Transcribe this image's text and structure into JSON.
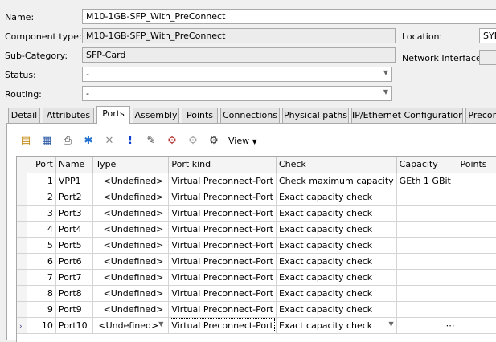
{
  "form": {
    "name_label": "Name:",
    "name_value": "M10-1GB-SFP_With_PreConnect",
    "component_type_label": "Component type:",
    "component_type_value": "M10-1GB-SFP_With_PreConnect",
    "subcategory_label": "Sub-Category:",
    "subcategory_value": "SFP-Card",
    "status_label": "Status:",
    "status_value": "-",
    "routing_label": "Routing:",
    "routing_value": "-",
    "location_label": "Location:",
    "location_value": "SYD",
    "network_interface_label": "Network Interface:",
    "network_interface_value": ""
  },
  "tabs": [
    {
      "label": "Detail"
    },
    {
      "label": "Attributes"
    },
    {
      "label": "Ports"
    },
    {
      "label": "Assembly"
    },
    {
      "label": "Points"
    },
    {
      "label": "Connections"
    },
    {
      "label": "Physical paths"
    },
    {
      "label": "IP/Ethernet Configuration"
    },
    {
      "label": "Precon"
    }
  ],
  "active_tab": "Ports",
  "toolbar": {
    "view_label": "View",
    "icons": [
      "new-port-icon",
      "edit-port-icon",
      "print-icon",
      "star-icon",
      "delete-icon",
      "exclamation-icon",
      "pick-icon",
      "global-port-icon",
      "port-settings-icon",
      "port-parameters-icon"
    ]
  },
  "grid": {
    "columns": [
      "Port",
      "Name",
      "Type",
      "Port kind",
      "Check",
      "Capacity",
      "Points"
    ],
    "rows": [
      {
        "port": "1",
        "name": "VPP1",
        "type": "<Undefined>",
        "kind": "Virtual Preconnect-Port",
        "check": "Check maximum capacity",
        "capacity": "GEth 1 GBit",
        "points": ""
      },
      {
        "port": "2",
        "name": "Port2",
        "type": "<Undefined>",
        "kind": "Virtual Preconnect-Port",
        "check": "Exact capacity check",
        "capacity": "",
        "points": ""
      },
      {
        "port": "3",
        "name": "Port3",
        "type": "<Undefined>",
        "kind": "Virtual Preconnect-Port",
        "check": "Exact capacity check",
        "capacity": "",
        "points": ""
      },
      {
        "port": "4",
        "name": "Port4",
        "type": "<Undefined>",
        "kind": "Virtual Preconnect-Port",
        "check": "Exact capacity check",
        "capacity": "",
        "points": ""
      },
      {
        "port": "5",
        "name": "Port5",
        "type": "<Undefined>",
        "kind": "Virtual Preconnect-Port",
        "check": "Exact capacity check",
        "capacity": "",
        "points": ""
      },
      {
        "port": "6",
        "name": "Port6",
        "type": "<Undefined>",
        "kind": "Virtual Preconnect-Port",
        "check": "Exact capacity check",
        "capacity": "",
        "points": ""
      },
      {
        "port": "7",
        "name": "Port7",
        "type": "<Undefined>",
        "kind": "Virtual Preconnect-Port",
        "check": "Exact capacity check",
        "capacity": "",
        "points": ""
      },
      {
        "port": "8",
        "name": "Port8",
        "type": "<Undefined>",
        "kind": "Virtual Preconnect-Port",
        "check": "Exact capacity check",
        "capacity": "",
        "points": ""
      },
      {
        "port": "9",
        "name": "Port9",
        "type": "<Undefined>",
        "kind": "Virtual Preconnect-Port",
        "check": "Exact capacity check",
        "capacity": "",
        "points": ""
      },
      {
        "port": "10",
        "name": "Port10",
        "type": "<Undefined>",
        "kind": "Virtual Preconnect-Port",
        "check": "Exact capacity check",
        "capacity": "",
        "points": "⋯"
      }
    ],
    "current_row_index": 9
  }
}
